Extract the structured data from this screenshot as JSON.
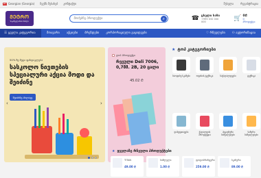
{
  "topbar": {
    "language": "Georgian (Georgia)",
    "links": [
      "ჩვენს შესახებ",
      "კონტაქტი"
    ],
    "right": [
      "შესვლა",
      "რეგისტრაცია"
    ]
  },
  "header": {
    "logo": "ᲛᲔᲢᲠᲝ",
    "logo_sub": "საკანცელარიო სახლი",
    "search_placeholder": "მოძებნე პროდუქტი",
    "phone_title": "ცხელი ხაზი",
    "phone_number": "+995 032 000 000",
    "cart_title": "0₾",
    "cart_sub": "0 პროდუქტი"
  },
  "nav": {
    "categories": "ყველა კატეგორია",
    "items": [
      "მთავარი",
      "აქციები",
      "ბრენდები",
      "კორპორაციული გაყიდვები"
    ],
    "right": [
      "რჩეულები",
      "ავტორიზაცია"
    ]
  },
  "hero": {
    "small": "50% ზე მეტი ფასდაკლება",
    "big": "სასკოლო ნივთების სპეციალური აქცია მოდი და შეიძინე",
    "button": "შეიძინე ახლავე"
  },
  "promo": {
    "badge": "ტოპ პროდუქტი",
    "title": "რვეული Deli 7006, 0,7მმ. 2B, 20 ცალი",
    "price": "45.02 ₾"
  },
  "top_cats": {
    "title": "ტოპ კატეგორიები",
    "items": [
      {
        "label": "საოფისე სკამები",
        "icon": "chair-icon",
        "color": "#3a3a3a"
      },
      {
        "label": "ოფისის ტექნიკა",
        "icon": "printer-icon",
        "color": "#5f6b7b"
      },
      {
        "label": "საქაღალდეები",
        "icon": "folder-icon",
        "color": "#f0a43a"
      },
      {
        "label": "ტექნიკა",
        "icon": "appliance-icon",
        "color": "#d8dde6"
      },
      {
        "label": "დასუფთავება",
        "icon": "bottle-icon",
        "color": "#86b7d1"
      },
      {
        "label": "ქაღალდის პროდუქცია",
        "icon": "paper-icon",
        "color": "#e84a5f"
      },
      {
        "label": "ჰიგიენური საშუალებები",
        "icon": "gloves-icon",
        "color": "#3a8fe0"
      },
      {
        "label": "საწერი საშუალებები",
        "icon": "pens-icon",
        "color": "#ffb84d"
      }
    ]
  },
  "bottom": {
    "title": "ყველაზე რჩეული პროდუქტები",
    "products": [
      {
        "name": "TITAN",
        "price": "49.00 ₾"
      },
      {
        "name": "საშლელი",
        "price": "1.00 ₾"
      },
      {
        "name": "ფოტოპრინტერი",
        "price": "259.00 ₾"
      },
      {
        "name": "სკანერი",
        "price": "89.00 ₾"
      }
    ]
  },
  "colors": {
    "primary": "#2d58c3",
    "hero_bg": "#f4e6b5",
    "promo_bg": "#f3cddb"
  }
}
